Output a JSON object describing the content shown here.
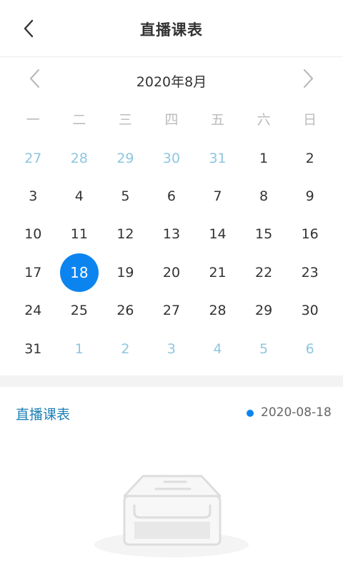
{
  "header": {
    "title": "直播课表",
    "back_icon": "chevron-left-icon"
  },
  "calendar": {
    "month_label": "2020年8月",
    "prev_icon": "chevron-left-icon",
    "next_icon": "chevron-right-icon",
    "weekdays": [
      "一",
      "二",
      "三",
      "四",
      "五",
      "六",
      "日"
    ],
    "days": [
      {
        "d": "27",
        "other": true
      },
      {
        "d": "28",
        "other": true
      },
      {
        "d": "29",
        "other": true
      },
      {
        "d": "30",
        "other": true
      },
      {
        "d": "31",
        "other": true
      },
      {
        "d": "1"
      },
      {
        "d": "2"
      },
      {
        "d": "3"
      },
      {
        "d": "4"
      },
      {
        "d": "5"
      },
      {
        "d": "6"
      },
      {
        "d": "7"
      },
      {
        "d": "8"
      },
      {
        "d": "9"
      },
      {
        "d": "10"
      },
      {
        "d": "11"
      },
      {
        "d": "12"
      },
      {
        "d": "13"
      },
      {
        "d": "14"
      },
      {
        "d": "15"
      },
      {
        "d": "16"
      },
      {
        "d": "17"
      },
      {
        "d": "18",
        "selected": true
      },
      {
        "d": "19"
      },
      {
        "d": "20"
      },
      {
        "d": "21"
      },
      {
        "d": "22"
      },
      {
        "d": "23"
      },
      {
        "d": "24"
      },
      {
        "d": "25"
      },
      {
        "d": "26"
      },
      {
        "d": "27"
      },
      {
        "d": "28"
      },
      {
        "d": "29"
      },
      {
        "d": "30"
      },
      {
        "d": "31"
      },
      {
        "d": "1",
        "other": true
      },
      {
        "d": "2",
        "other": true
      },
      {
        "d": "3",
        "other": true
      },
      {
        "d": "4",
        "other": true
      },
      {
        "d": "5",
        "other": true
      },
      {
        "d": "6",
        "other": true
      }
    ],
    "colors": {
      "accent": "#0b84f0",
      "other_month": "#8ec6e0",
      "weekday": "#bbbbbb"
    }
  },
  "schedule": {
    "title": "直播课表",
    "selected_date": "2020-08-18",
    "empty_icon": "empty-inbox-icon"
  }
}
